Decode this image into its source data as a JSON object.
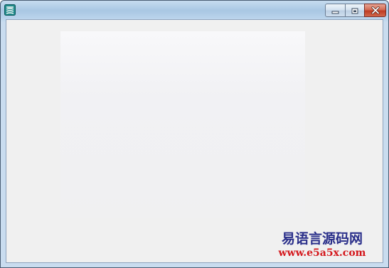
{
  "window": {
    "title": "",
    "icon": "app-logo-icon"
  },
  "caption_buttons": {
    "minimize": "minimize-icon",
    "restore": "restore-icon",
    "close": "close-icon"
  },
  "watermark": {
    "site_name": "易语言源码网",
    "url": "www.e5a5x.com"
  },
  "colors": {
    "watermark_name": "#2a2f8a",
    "watermark_url": "#d4171c",
    "client_background": "#f0f0f0",
    "close_button": "#c94a32"
  }
}
